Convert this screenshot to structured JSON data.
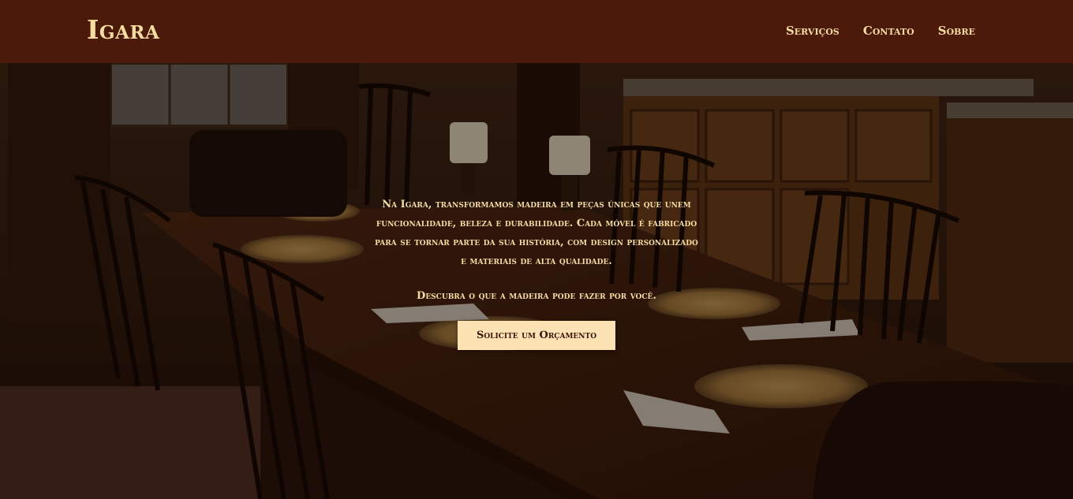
{
  "header": {
    "brand": "Igara",
    "nav": [
      {
        "label": "Serviços"
      },
      {
        "label": "Contato"
      },
      {
        "label": "Sobre"
      }
    ]
  },
  "hero": {
    "description": "Na Igara, transformamos madeira em peças únicas que unem funcionalidade, beleza e durabilidade. Cada móvel é fabricado para se tornar parte da sua história, com design personalizado e materiais de alta qualidade.",
    "tagline": "Descubra o que a madeira pode fazer por você.",
    "cta_label": "Solicite um Orçamento",
    "background_image": "dining-room-photo"
  },
  "colors": {
    "header_bg": "#4b1a0b",
    "text_accent": "#f5dca0",
    "button_bg": "#fde3b3",
    "button_text": "#3a1608"
  }
}
